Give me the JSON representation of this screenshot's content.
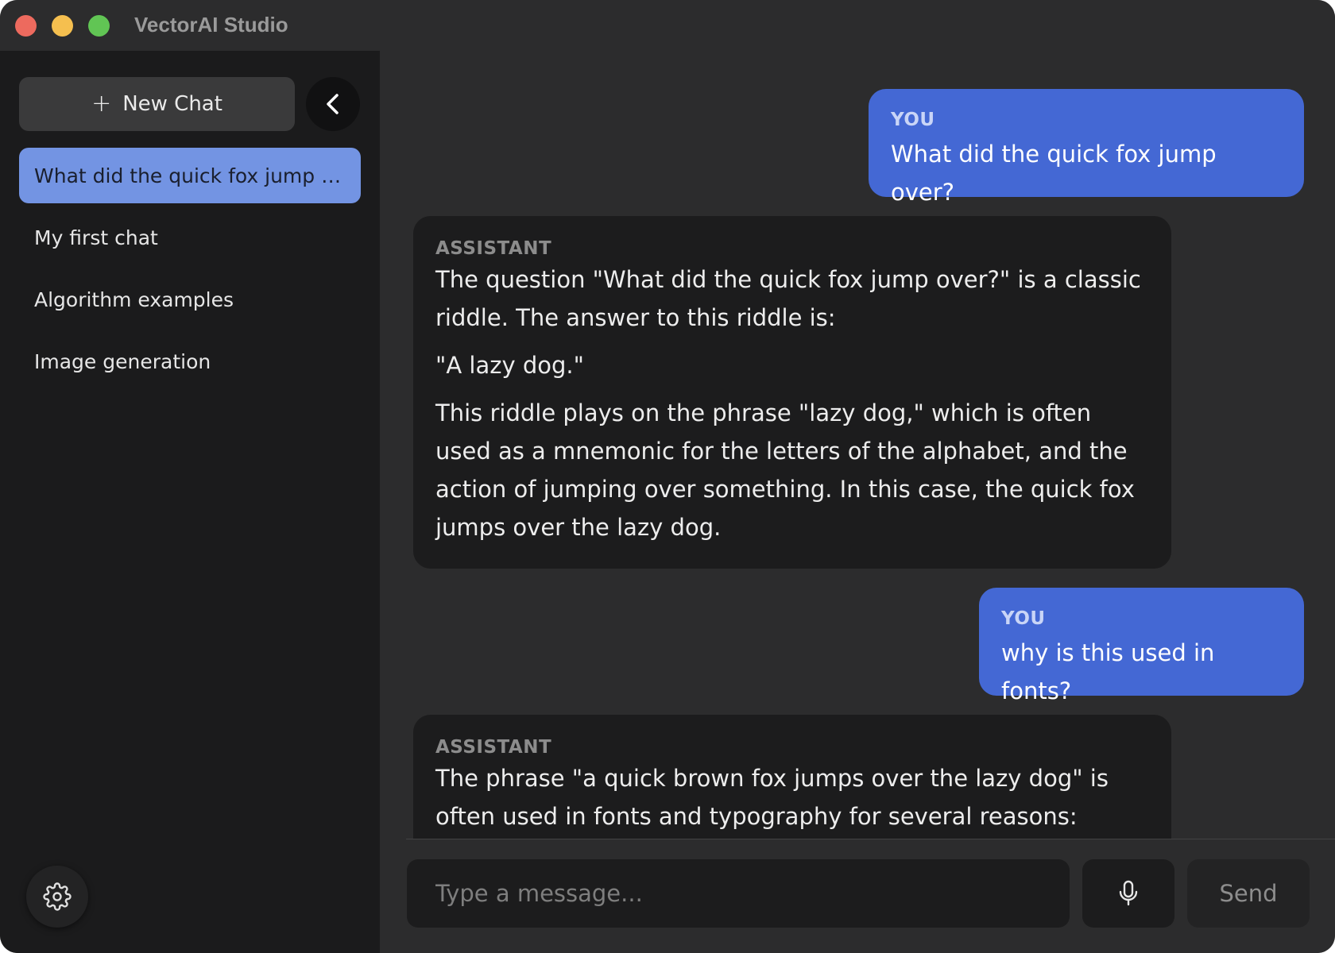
{
  "window": {
    "title": "VectorAI Studio"
  },
  "sidebar": {
    "new_chat_label": "New Chat",
    "new_chat_icon": "plus-icon",
    "collapse_icon": "chevron-left-icon",
    "settings_icon": "gear-icon",
    "chats": [
      {
        "label": "What did the quick fox jump over?",
        "active": true
      },
      {
        "label": "My first chat",
        "active": false
      },
      {
        "label": "Algorithm examples",
        "active": false
      },
      {
        "label": "Image generation",
        "active": false
      }
    ]
  },
  "messages": [
    {
      "role": "YOU",
      "paragraphs": [
        "What did the quick fox jump over?"
      ]
    },
    {
      "role": "ASSISTANT",
      "paragraphs": [
        "The question \"What did the quick fox jump over?\" is a classic riddle. The answer to this riddle is:",
        "\"A lazy dog.\"",
        "This riddle plays on the phrase \"lazy dog,\" which is often used as a mnemonic for the letters of the alphabet, and the action of jumping over something. In this case, the quick fox jumps over the lazy dog."
      ]
    },
    {
      "role": "YOU",
      "paragraphs": [
        "why is this used in fonts?"
      ]
    },
    {
      "role": "ASSISTANT",
      "paragraphs": [
        "The phrase \"a quick brown fox jumps over the lazy dog\" is often used in fonts and typography for several reasons:"
      ]
    }
  ],
  "composer": {
    "placeholder": "Type a message...",
    "value": "",
    "mic_icon": "microphone-icon",
    "send_label": "Send"
  },
  "colors": {
    "user_bubble": "#4468d4",
    "assistant_bubble": "#1c1c1d",
    "active_chat": "#7394e3",
    "sidebar_bg": "#1b1b1c",
    "main_bg": "#2c2c2d"
  }
}
